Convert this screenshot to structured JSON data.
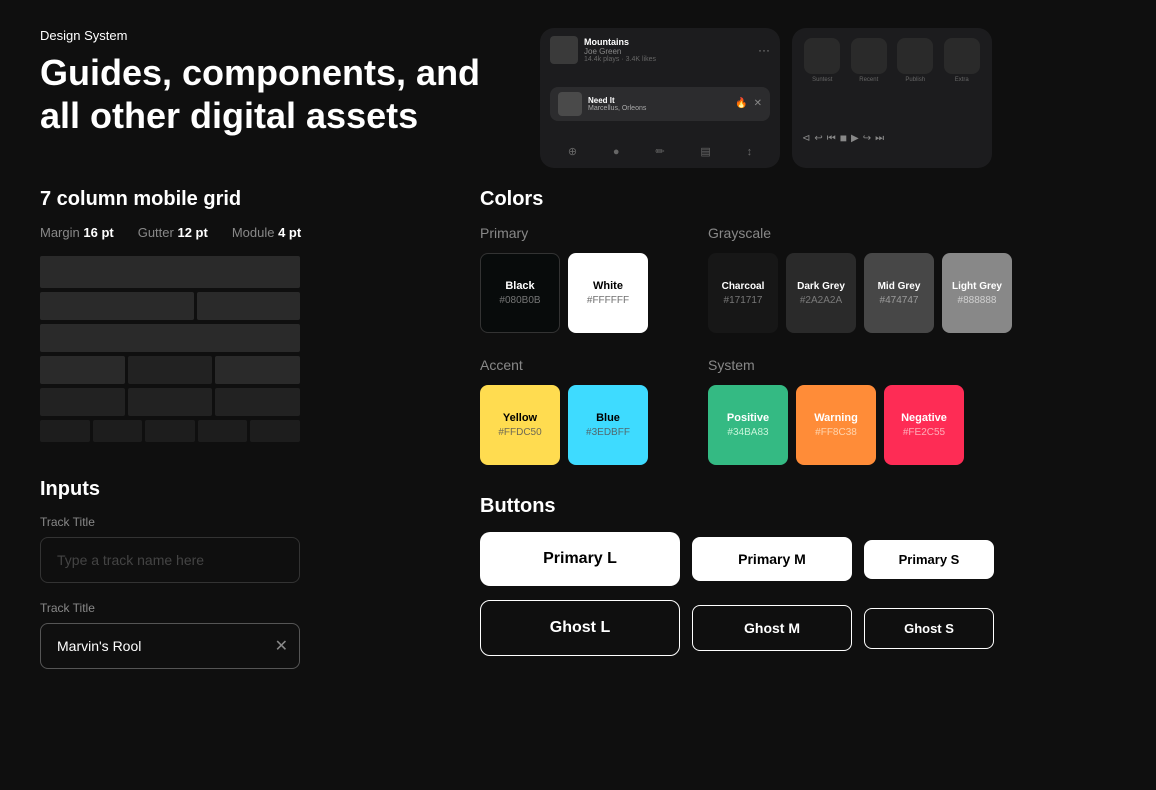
{
  "header": {
    "label": "Design System",
    "title_line1": "Guides, components, and",
    "title_line2": "all other digital assets"
  },
  "grid_section": {
    "title": "7 column mobile grid",
    "margin_label": "Margin",
    "margin_value": "16 pt",
    "gutter_label": "Gutter",
    "gutter_value": "12 pt",
    "module_label": "Module",
    "module_value": "4 pt"
  },
  "inputs_section": {
    "title": "Inputs",
    "track_title_label": "Track Title",
    "track_title_placeholder": "Type a track name here",
    "track_title_label2": "Track Title",
    "track_title_value": "Marvin's Rool"
  },
  "colors_section": {
    "title": "Colors",
    "primary": {
      "label": "Primary",
      "swatches": [
        {
          "name": "Black",
          "hex": "#080B0B",
          "display_hex": "#080B0B",
          "text_color": "#ffffff"
        },
        {
          "name": "White",
          "hex": "#FFFFFF",
          "display_hex": "#FFFFFF",
          "text_color": "#000000"
        }
      ]
    },
    "grayscale": {
      "label": "Grayscale",
      "swatches": [
        {
          "name": "Charcoal",
          "hex": "#171717",
          "display_hex": "#171717",
          "text_color": "#ffffff"
        },
        {
          "name": "Dark Grey",
          "hex": "#2A2A2A",
          "display_hex": "#2A2A2A",
          "text_color": "#ffffff"
        },
        {
          "name": "Mid Grey",
          "hex": "#474747",
          "display_hex": "#474747",
          "text_color": "#ffffff"
        },
        {
          "name": "Light Grey",
          "hex": "#888888",
          "display_hex": "#888888",
          "text_color": "#ffffff"
        }
      ]
    },
    "accent": {
      "label": "Accent",
      "swatches": [
        {
          "name": "Yellow",
          "hex": "#FFDC50",
          "display_hex": "#FFDC50",
          "text_color": "#000000"
        },
        {
          "name": "Blue",
          "hex": "#3EDBFF",
          "display_hex": "#3EDBFF",
          "text_color": "#000000"
        }
      ]
    },
    "system": {
      "label": "System",
      "swatches": [
        {
          "name": "Positive",
          "hex": "#34BA83",
          "display_hex": "#34BA83",
          "text_color": "#ffffff"
        },
        {
          "name": "Warning",
          "hex": "#FF8C38",
          "display_hex": "#FF8C38",
          "text_color": "#ffffff"
        },
        {
          "name": "Negative",
          "hex": "#FE2C55",
          "display_hex": "#FE2C55",
          "text_color": "#ffffff"
        }
      ]
    }
  },
  "buttons_section": {
    "title": "Buttons",
    "primary_l": "Primary L",
    "primary_m": "Primary M",
    "primary_s": "Primary S",
    "ghost_l": "Ghost L",
    "ghost_m": "Ghost M",
    "ghost_s": "Ghost S"
  },
  "player": {
    "track1": "Mountains",
    "artist1": "Joe Green",
    "now_playing_title": "Need It",
    "now_playing_artist": "Marcellus, Orleons"
  }
}
